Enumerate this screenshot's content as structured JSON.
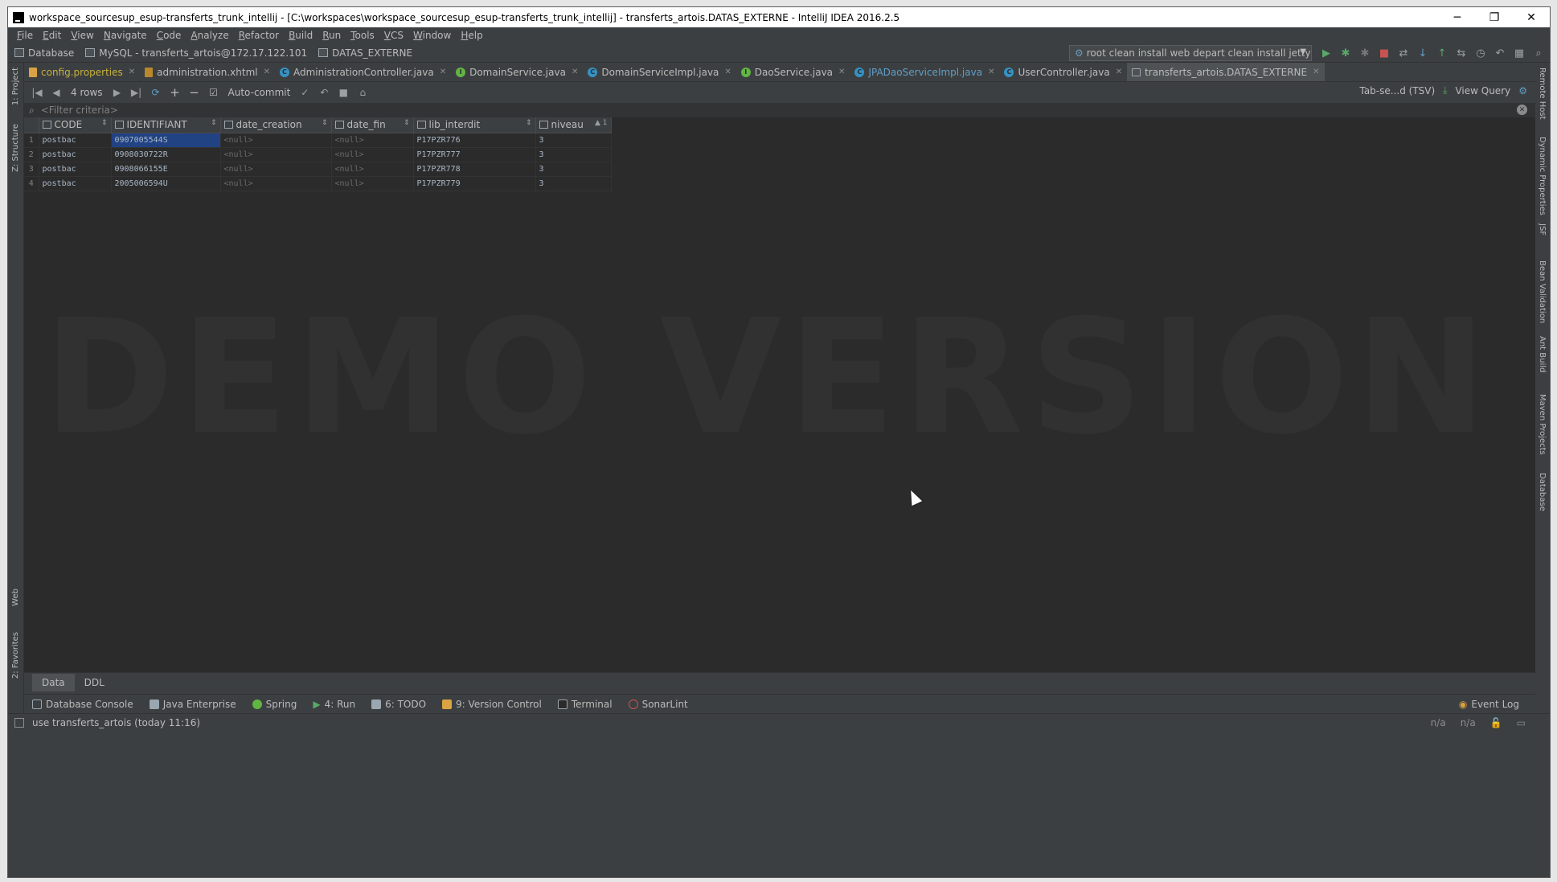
{
  "window": {
    "title": "workspace_sourcesup_esup-transferts_trunk_intellij - [C:\\workspaces\\workspace_sourcesup_esup-transferts_trunk_intellij] - transferts_artois.DATAS_EXTERNE - IntelliJ IDEA 2016.2.5",
    "controls": {
      "minimize": "─",
      "restore": "❐",
      "close": "✕"
    }
  },
  "menu": [
    "File",
    "Edit",
    "View",
    "Navigate",
    "Code",
    "Analyze",
    "Refactor",
    "Build",
    "Run",
    "Tools",
    "VCS",
    "Window",
    "Help"
  ],
  "breadcrumbs": [
    "Database",
    "MySQL - transferts_artois@172.17.122.101",
    "DATAS_EXTERNE"
  ],
  "run_config": "root clean install web depart clean install jetty:run",
  "tabs": [
    {
      "label": "config.properties",
      "icon": "properties-file-icon"
    },
    {
      "label": "administration.xhtml",
      "icon": "xhtml-file-icon"
    },
    {
      "label": "AdministrationController.java",
      "icon": "class-icon"
    },
    {
      "label": "DomainService.java",
      "icon": "interface-icon"
    },
    {
      "label": "DomainServiceImpl.java",
      "icon": "class-icon"
    },
    {
      "label": "DaoService.java",
      "icon": "interface-icon"
    },
    {
      "label": "JPADaoServiceImpl.java",
      "icon": "class-icon"
    },
    {
      "label": "UserController.java",
      "icon": "class-icon"
    },
    {
      "label": "transferts_artois.DATAS_EXTERNE",
      "icon": "table-icon"
    }
  ],
  "grid_toolbar": {
    "rows_label": "4 rows",
    "autocommit_label": "Auto-commit",
    "export_format": "Tab-se...d (TSV)",
    "view_query": "View Query"
  },
  "filter": {
    "placeholder": "<Filter criteria>"
  },
  "table": {
    "columns": [
      "CODE",
      "IDENTIFIANT",
      "date_creation",
      "date_fin",
      "lib_interdit",
      "niveau"
    ],
    "sort_indicator": "▲ 1",
    "rows": [
      {
        "n": "1",
        "code": "postbac",
        "id": "0907005544S",
        "date_creation": "<null>",
        "date_fin": "<null>",
        "lib": "P17PZR776",
        "niveau": "3"
      },
      {
        "n": "2",
        "code": "postbac",
        "id": "0908030722R",
        "date_creation": "<null>",
        "date_fin": "<null>",
        "lib": "P17PZR777",
        "niveau": "3"
      },
      {
        "n": "3",
        "code": "postbac",
        "id": "0908066155E",
        "date_creation": "<null>",
        "date_fin": "<null>",
        "lib": "P17PZR778",
        "niveau": "3"
      },
      {
        "n": "4",
        "code": "postbac",
        "id": "2005006594U",
        "date_creation": "<null>",
        "date_fin": "<null>",
        "lib": "P17PZR779",
        "niveau": "3"
      }
    ]
  },
  "watermark": "DEMO VERSION",
  "bottom_tabs": [
    "Data",
    "DDL"
  ],
  "tool_windows": [
    "Database Console",
    "Java Enterprise",
    "Spring",
    "4: Run",
    "6: TODO",
    "9: Version Control",
    "Terminal",
    "SonarLint"
  ],
  "event_log": "Event Log",
  "left_stripe": [
    "1: Project",
    "Z: Structure",
    "Web",
    "2: Favorites"
  ],
  "right_stripe": [
    "Remote Host",
    "Dynamic Properties",
    "JSF",
    "Bean Validation",
    "Ant Build",
    "Maven Projects",
    "Database"
  ],
  "status": {
    "message": "use transferts_artois (today 11:16)",
    "pos1": "n/a",
    "pos2": "n/a"
  }
}
